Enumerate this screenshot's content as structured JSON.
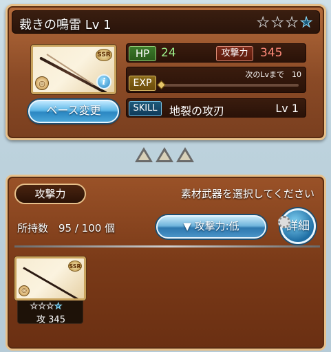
{
  "weapon": {
    "title": "裁きの鳴雷 Lv 1",
    "rarity": "SSR",
    "element_icon": "light-element-icon",
    "stars": [
      false,
      false,
      false,
      true
    ],
    "hp_label": "HP",
    "hp_value": "24",
    "atk_label": "攻撃力",
    "atk_value": "345",
    "exp_label": "EXP",
    "next_level_text": "次のLvまで　10",
    "exp_progress": 0,
    "skill_label": "SKILL",
    "skill_name": "地裂の攻刃",
    "skill_level": "Lv 1",
    "base_change_label": "ベース変更"
  },
  "material": {
    "tab_label": "攻撃力",
    "hint": "素材武器を選択してください",
    "owned_text": "所持数　95 / 100 個",
    "sort_label": "▼ 攻撃力:低",
    "detail_label": "詳細",
    "items": [
      {
        "rarity": "SSR",
        "atk_text": "攻 345",
        "stars": [
          false,
          false,
          false,
          true
        ]
      }
    ]
  },
  "colors": {
    "hp": "#9ef08a",
    "atk": "#ff8a7a",
    "accent_blue": "#2b87c2",
    "panel_border": "#e7c08a"
  }
}
